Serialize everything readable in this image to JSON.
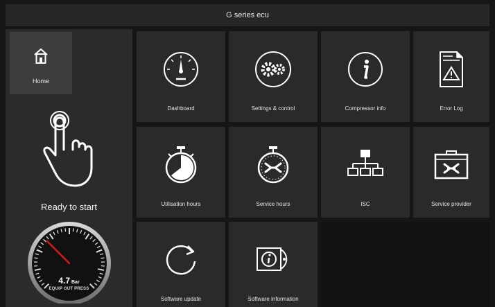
{
  "window": {
    "title": "G series ecu"
  },
  "sidebar": {
    "home_label": "Home",
    "status_text": "Ready to start",
    "gauge": {
      "value": "4.7",
      "unit": "Bar",
      "label": "EQUIP OUT PRESS"
    }
  },
  "tiles": [
    {
      "label": "Dashboard",
      "icon": "dashboard-gauge-icon"
    },
    {
      "label": "Settings & control",
      "icon": "gears-icon"
    },
    {
      "label": "Compressor info",
      "icon": "info-icon"
    },
    {
      "label": "Error Log",
      "icon": "error-log-icon"
    },
    {
      "label": "Utilisation hours",
      "icon": "stopwatch-icon"
    },
    {
      "label": "Service hours",
      "icon": "service-timer-icon"
    },
    {
      "label": "ISC",
      "icon": "network-icon"
    },
    {
      "label": "Service provider",
      "icon": "toolbox-icon"
    },
    {
      "label": "Software update",
      "icon": "refresh-icon"
    },
    {
      "label": "Software information",
      "icon": "software-info-icon"
    }
  ],
  "colors": {
    "background": "#161616",
    "tile": "#2a2a2a",
    "sidebar": "#2b2b2b",
    "home_active": "#3d3d3d",
    "needle": "#d11a1a"
  }
}
